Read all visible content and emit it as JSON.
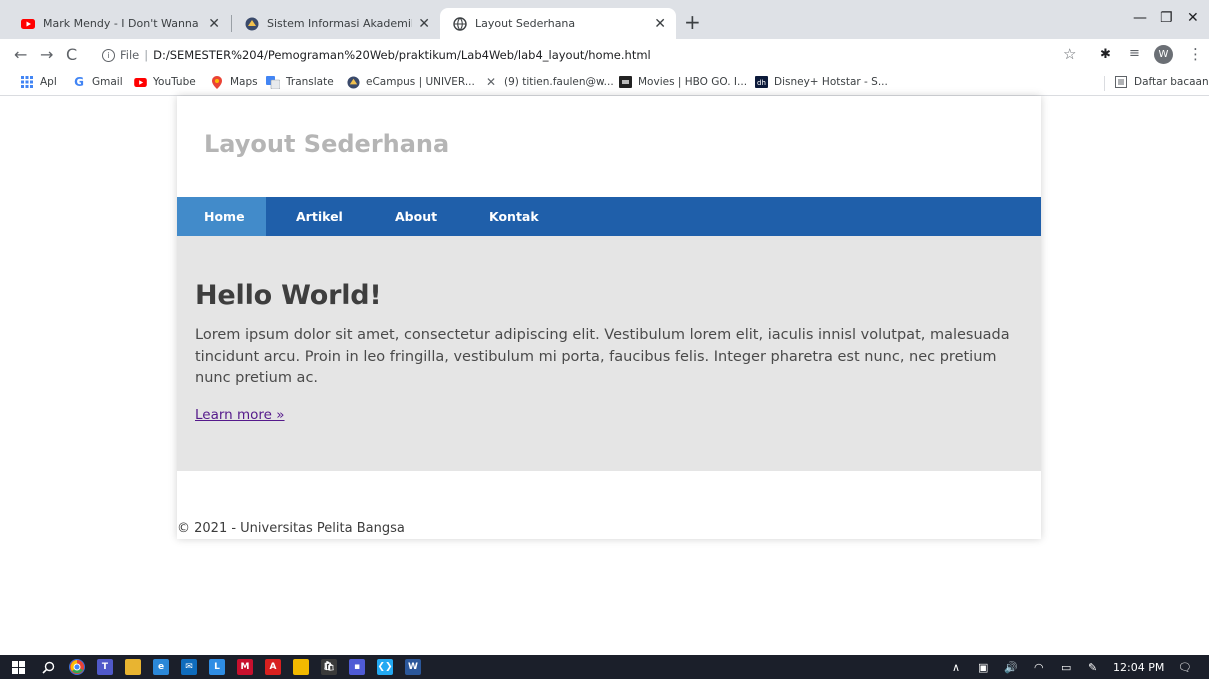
{
  "browser": {
    "tabs": [
      {
        "title": "Mark Mendy - I Don't Wanna Be",
        "icon": "youtube-icon"
      },
      {
        "title": "Sistem Informasi Akademik",
        "icon": "campus-icon"
      },
      {
        "title": "Layout Sederhana",
        "icon": "globe-icon"
      }
    ],
    "new_tab": "+",
    "address": {
      "scheme_label": "File",
      "url": "D:/SEMESTER%204/Pemograman%20Web/praktikum/Lab4Web/lab4_layout/home.html"
    },
    "profile_initial": "W",
    "bookmarks": [
      {
        "label": "Apl",
        "icon": "apps-grid-icon"
      },
      {
        "label": "Gmail",
        "icon": "google-icon"
      },
      {
        "label": "YouTube",
        "icon": "youtube-icon"
      },
      {
        "label": "Maps",
        "icon": "maps-pin-icon"
      },
      {
        "label": "Translate",
        "icon": "translate-icon"
      },
      {
        "label": "eCampus | UNIVER...",
        "icon": "campus-icon"
      },
      {
        "label": "(9) titien.faulen@w...",
        "icon": "mail-icon"
      },
      {
        "label": "Movies | HBO GO. I...",
        "icon": "hbo-icon"
      },
      {
        "label": "Disney+ Hotstar - S...",
        "icon": "hotstar-icon"
      }
    ],
    "reading_list": "Daftar bacaan"
  },
  "site": {
    "title": "Layout Sederhana",
    "nav": [
      {
        "label": "Home",
        "active": true
      },
      {
        "label": "Artikel",
        "active": false
      },
      {
        "label": "About",
        "active": false
      },
      {
        "label": "Kontak",
        "active": false
      }
    ],
    "hero": {
      "heading": "Hello World!",
      "body": "Lorem ipsum dolor sit amet, consectetur adipiscing elit. Vestibulum lorem elit, iaculis innisl volutpat, malesuada tincidunt arcu. Proin in leo fringilla, vestibulum mi porta, faucibus felis. Integer pharetra est nunc, nec pretium nunc pretium ac.",
      "link": "Learn more »"
    },
    "footer": "© 2021 - Universitas Pelita Bangsa"
  },
  "taskbar": {
    "clock": "12:04 PM"
  },
  "colors": {
    "nav_bg": "#1f5faa",
    "nav_active": "#428bca",
    "hero_bg": "#e5e5e5",
    "title_gray": "#b5b5b5",
    "taskbar_bg": "#1b1f2a"
  }
}
